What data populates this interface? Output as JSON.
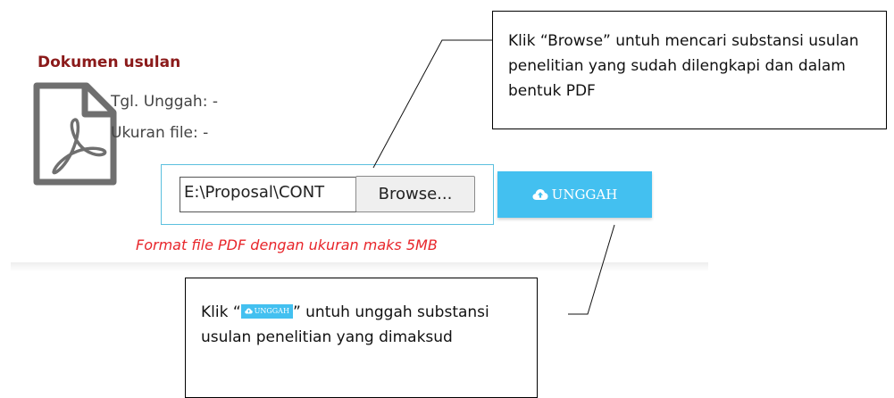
{
  "document": {
    "section_title": "Dokumen usulan",
    "upload_date_label": "Tgl. Unggah: -",
    "file_size_label": "Ukuran file: -",
    "icon": "pdf-file-icon"
  },
  "upload": {
    "file_path_value": "E:\\Proposal\\CONT",
    "browse_label": "Browse...",
    "upload_button_label": "UNGGAH",
    "upload_icon": "cloud-upload-icon",
    "format_note": "Format file PDF dengan ukuran maks 5MB"
  },
  "callouts": {
    "browse_text": "Klik “Browse” untuh mencari substansi usulan penelitian yang sudah dilengkapi dan dalam bentuk PDF",
    "upload_prefix": "Klik “",
    "upload_inline_label": "UNGGAH",
    "upload_suffix": "” untuh unggah substansi usulan penelitian yang dimaksud"
  },
  "colors": {
    "title": "#8b1a1a",
    "accent_blue": "#43c0f0",
    "frame_border": "#5bc0de",
    "warning_red": "#e8262b"
  }
}
